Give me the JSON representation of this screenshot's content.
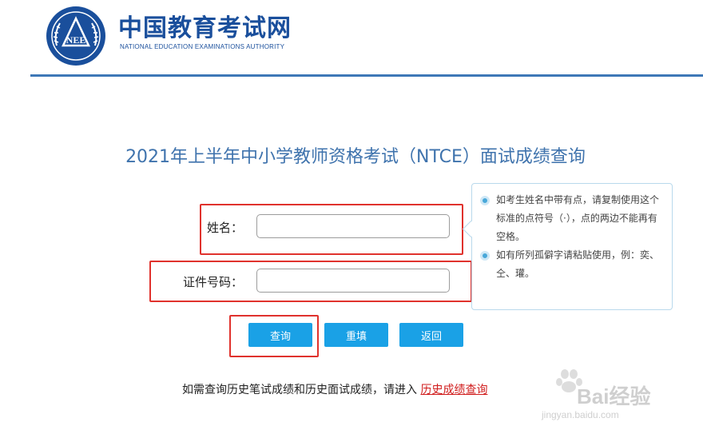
{
  "header": {
    "logo_emblem_text": "NEE",
    "logo_cn": "中国教育考试网",
    "logo_en": "NATIONAL EDUCATION EXAMINATIONS AUTHORITY"
  },
  "main": {
    "title": "2021年上半年中小学教师资格考试（NTCE）面试成绩查询",
    "form": {
      "name_label": "姓名：",
      "name_value": "",
      "id_label": "证件号码：",
      "id_value": ""
    },
    "tips": [
      "如考生姓名中带有点，请复制使用这个标准的点符号（·），点的两边不能再有空格。",
      "如有所列孤僻字请粘贴使用，例：奕、仝、瓘。"
    ],
    "buttons": {
      "query": "查询",
      "reset": "重填",
      "back": "返回"
    },
    "footer": {
      "note": "如需查询历史笔试成绩和历史面试成绩，请进入",
      "link": "历史成绩查询"
    }
  },
  "watermark": {
    "text": "Bai经验",
    "sub": "jingyan.baidu.com"
  },
  "colors": {
    "brand_blue": "#1a4f9c",
    "title_blue": "#3f73ad",
    "button_blue": "#1aa1e6",
    "highlight_red": "#e0322d",
    "link_red": "#d01c1c"
  }
}
